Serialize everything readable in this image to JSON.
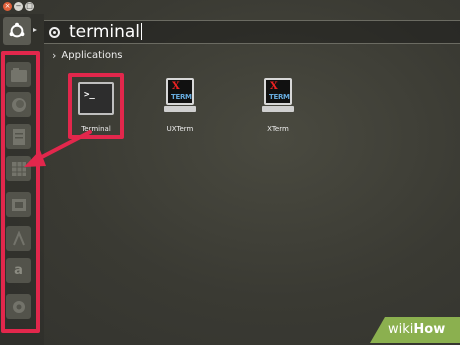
{
  "window_controls": {
    "close": "×",
    "minimize": "−",
    "maximize": "□"
  },
  "search": {
    "query": "terminal"
  },
  "section": {
    "label": "Applications"
  },
  "apps": [
    {
      "label": "Terminal",
      "prompt": ">_"
    },
    {
      "label": "UXTerm",
      "x_letter": "X",
      "term_text": "TERM"
    },
    {
      "label": "XTerm",
      "x_letter": "X",
      "term_text": "TERM"
    }
  ],
  "launcher": {
    "items": [
      "files",
      "firefox",
      "libreoffice-writer",
      "libreoffice-calc",
      "libreoffice-impress",
      "ubuntu-software",
      "amazon",
      "system-settings"
    ],
    "amazon_glyph": "a"
  },
  "watermark": {
    "prefix": "wiki",
    "suffix": "How"
  },
  "colors": {
    "highlight": "#e2274c",
    "watermark_bg": "#8bb04f"
  }
}
